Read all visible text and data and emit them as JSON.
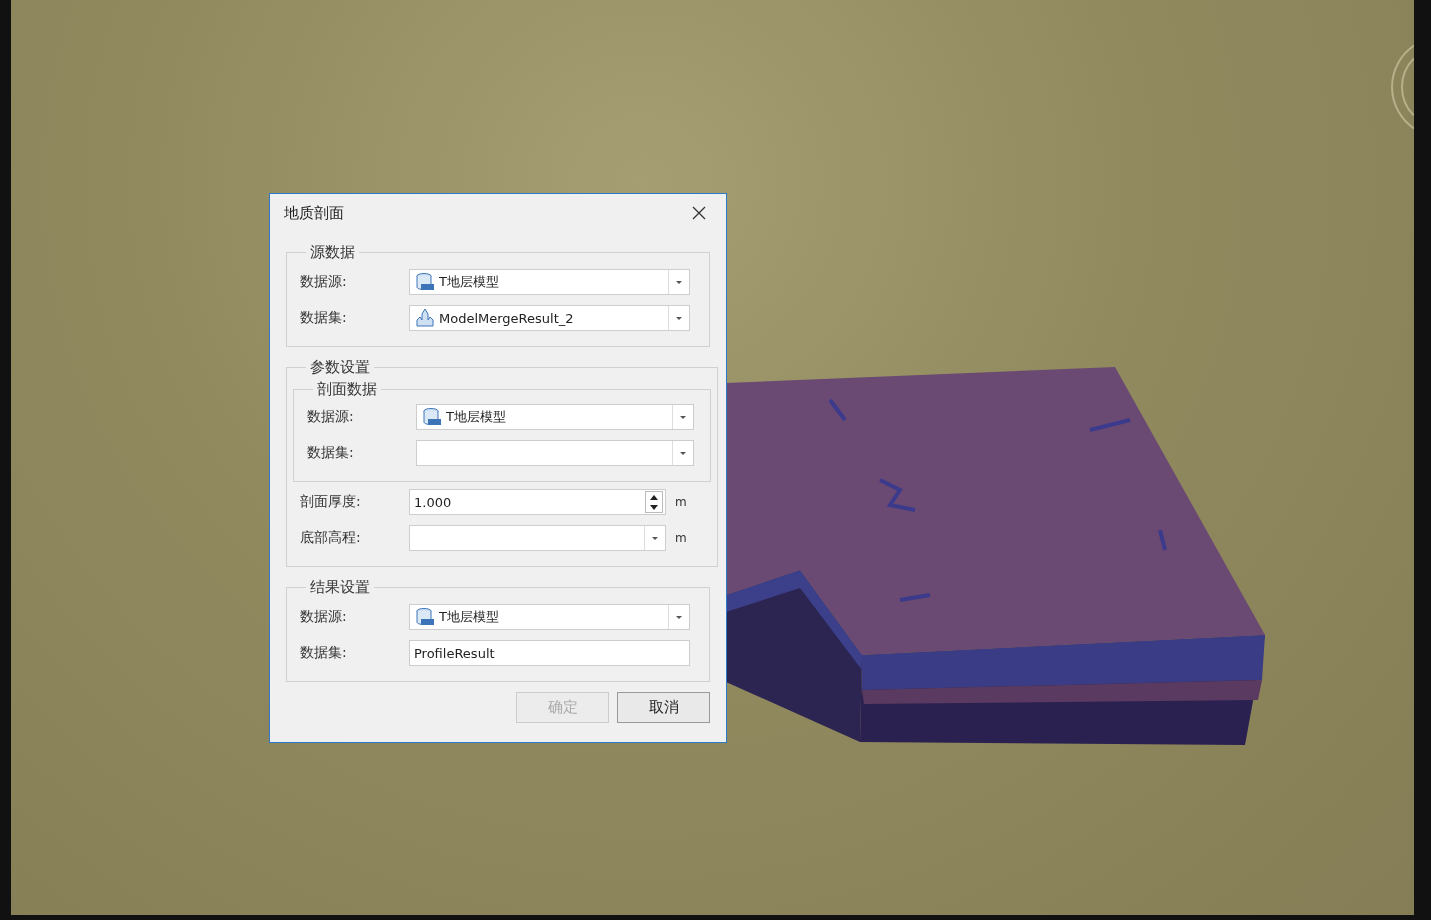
{
  "dialog": {
    "title": "地质剖面",
    "source": {
      "legend": "源数据",
      "fields": [
        {
          "kind": "source",
          "label": "数据源:",
          "value": "T地层模型"
        },
        {
          "kind": "model",
          "label": "数据集:",
          "value": "ModelMergeResult_2"
        }
      ]
    },
    "params": {
      "legend": "参数设置",
      "subgroup": {
        "legend": "剖面数据",
        "fields": [
          {
            "kind": "source",
            "label": "数据源:",
            "value": "T地层模型"
          },
          {
            "kind": "combo",
            "label": "数据集:"
          }
        ]
      },
      "fields": [
        {
          "kind": "spin",
          "label": "剖面厚度:",
          "value": "1.000",
          "unit": "m"
        },
        {
          "kind": "combo",
          "label": "底部高程:",
          "unit": "m"
        }
      ]
    },
    "result": {
      "legend": "结果设置",
      "fields": [
        {
          "kind": "source",
          "label": "数据源:",
          "value": "T地层模型"
        },
        {
          "kind": "text",
          "label": "数据集:",
          "value": "ProfileResult"
        }
      ]
    },
    "buttons": [
      {
        "label": "确定",
        "disabled": true
      },
      {
        "label": "取消",
        "disabled": false
      }
    ]
  }
}
